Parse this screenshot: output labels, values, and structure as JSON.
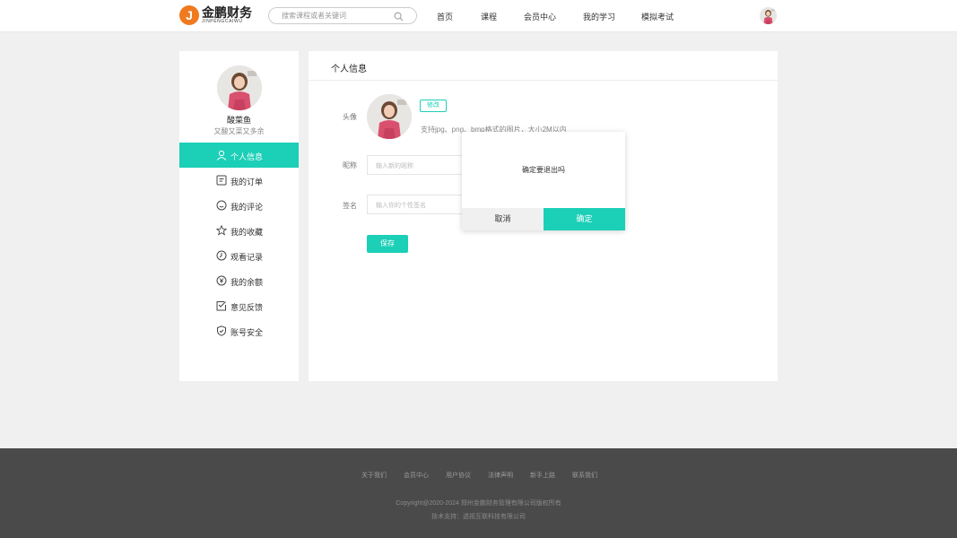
{
  "header": {
    "logo_cn": "金鹏财务",
    "logo_en": "JINPENGCAIWU",
    "search_placeholder": "搜索课程或者关键词",
    "nav": [
      "首页",
      "课程",
      "会员中心",
      "我的学习",
      "模拟考试"
    ]
  },
  "profile": {
    "name": "酸菜鱼",
    "signature": "又酸又菜又多余"
  },
  "sidebar": {
    "items": [
      {
        "label": "个人信息",
        "icon": "user-icon",
        "active": true
      },
      {
        "label": "我的订单",
        "icon": "order-icon",
        "active": false
      },
      {
        "label": "我的评论",
        "icon": "comment-icon",
        "active": false
      },
      {
        "label": "我的收藏",
        "icon": "star-icon",
        "active": false
      },
      {
        "label": "观看记录",
        "icon": "clock-icon",
        "active": false
      },
      {
        "label": "我的余额",
        "icon": "yen-icon",
        "active": false
      },
      {
        "label": "意见反馈",
        "icon": "feedback-icon",
        "active": false
      },
      {
        "label": "账号安全",
        "icon": "shield-icon",
        "active": false
      }
    ]
  },
  "main": {
    "title": "个人信息",
    "avatar_label": "头像",
    "edit_label": "修改",
    "hint": "支持jpg、png、bmp格式的图片，大小2M以内",
    "nickname_label": "昵称",
    "nickname_placeholder": "输入新的昵称",
    "signature_label": "签名",
    "signature_placeholder": "输入你的个性签名",
    "save_label": "保存"
  },
  "dialog": {
    "message": "确定要退出吗",
    "cancel_label": "取消",
    "confirm_label": "确定"
  },
  "footer": {
    "links": [
      "关于我们",
      "会员中心",
      "用户协议",
      "法律声明",
      "新手上路",
      "联系我们"
    ],
    "copyright": "Copyright@2020-2024 郑州金鹏财务管理有限公司版权所有",
    "support": "技术支持：透视互联科技有限公司"
  },
  "colors": {
    "accent": "#1ccfb7",
    "logo": "#f07a1f",
    "footer_bg": "#4a4a4a"
  }
}
